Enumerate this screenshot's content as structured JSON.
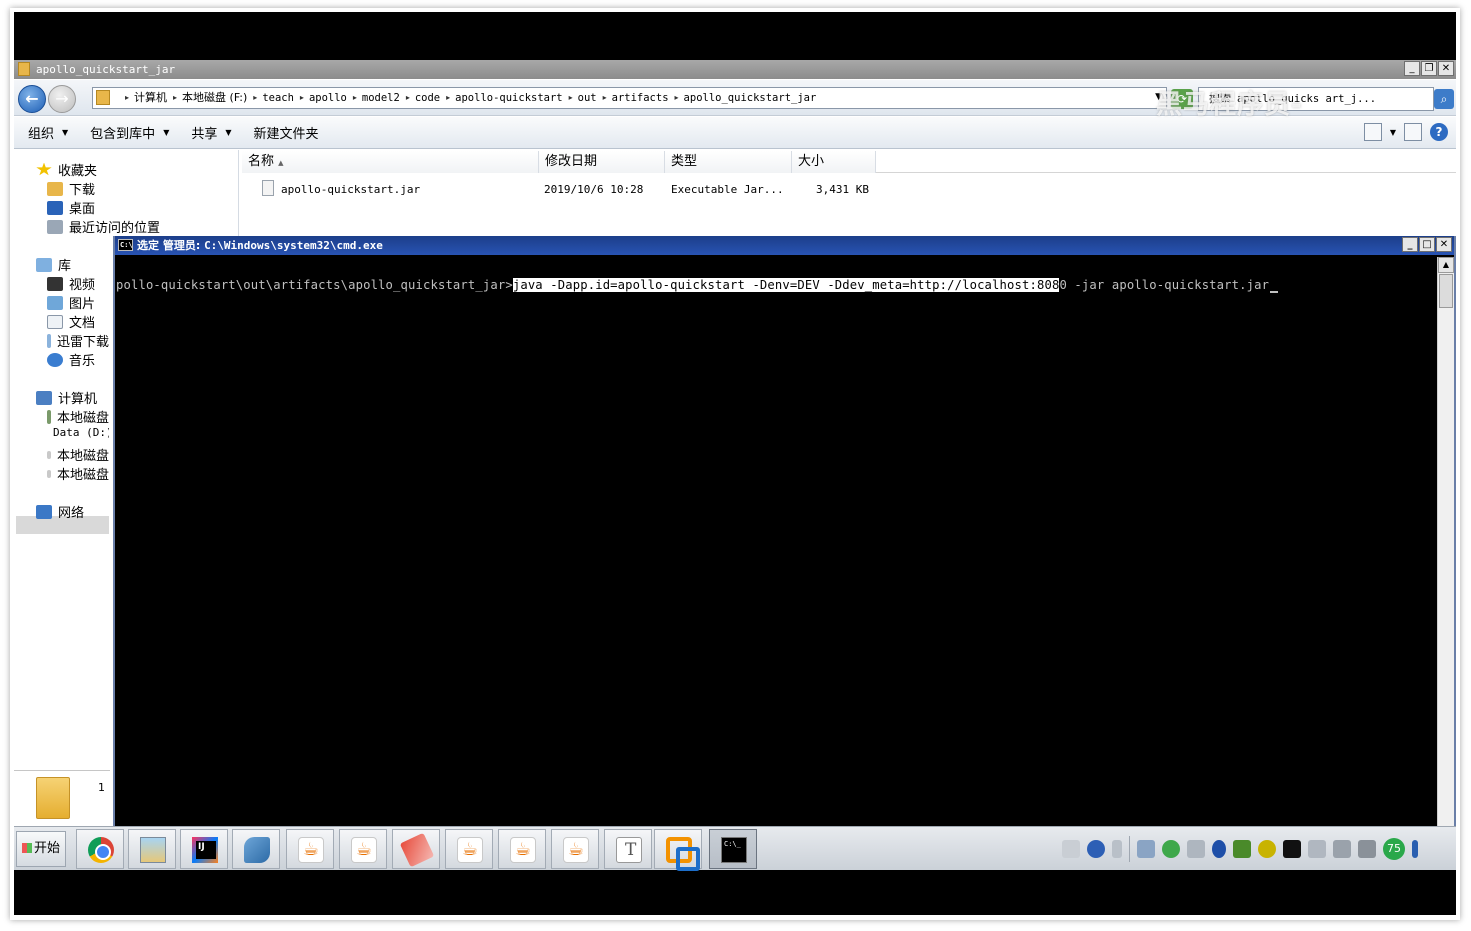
{
  "explorer": {
    "title": "apollo_quickstart_jar",
    "breadcrumb": [
      "计算机",
      "本地磁盘 (F:)",
      "teach",
      "apollo",
      "model2",
      "code",
      "apollo-quickstart",
      "out",
      "artifacts",
      "apollo_quickstart_jar"
    ],
    "search": {
      "label": "搜索",
      "value": "apollo_quicks art_j..."
    },
    "watermark": "黑马程序员-",
    "toolbar": {
      "organize": "组织",
      "include_library": "包含到库中",
      "share": "共享",
      "new_folder": "新建文件夹"
    },
    "nav": {
      "favorites": "收藏夹",
      "downloads": "下载",
      "desktop": "桌面",
      "recent": "最近访问的位置",
      "libraries": "库",
      "videos": "视频",
      "pictures": "图片",
      "documents": "文档",
      "xunlei": "迅雷下载",
      "music": "音乐",
      "computer": "计算机",
      "drive_c": "本地磁盘",
      "drive_d": "Data (D:)",
      "drive_e": "本地磁盘",
      "drive_f": "本地磁盘",
      "network": "网络"
    },
    "details_count": "1",
    "columns": {
      "name": "名称",
      "modified": "修改日期",
      "type": "类型",
      "size": "大小"
    },
    "files": [
      {
        "name": "apollo-quickstart.jar",
        "modified": "2019/10/6 10:28",
        "type": "Executable Jar...",
        "size": "3,431 KB"
      }
    ]
  },
  "cmd": {
    "title_prefix": "选定 管理员: ",
    "title_path": "C:\\Windows\\system32\\cmd.exe",
    "prompt": "pollo-quickstart\\out\\artifacts\\apollo_quickstart_jar>",
    "selected_text": "java -Dapp.id=apollo-quickstart -Denv=DEV -Ddev_meta=http://localhost:808",
    "rest_text": "0 -jar apollo-quickstart.jar"
  },
  "taskbar": {
    "start_label": "开始",
    "apps": [
      "chrome-icon",
      "file-explorer-icon",
      "intellij-icon",
      "dolphin-icon",
      "java-icon",
      "java-icon",
      "eraser-icon",
      "java-icon",
      "java-icon",
      "java-icon",
      "typora-icon",
      "vmware-icon",
      "cmd-icon"
    ],
    "tray_badge": "75"
  }
}
